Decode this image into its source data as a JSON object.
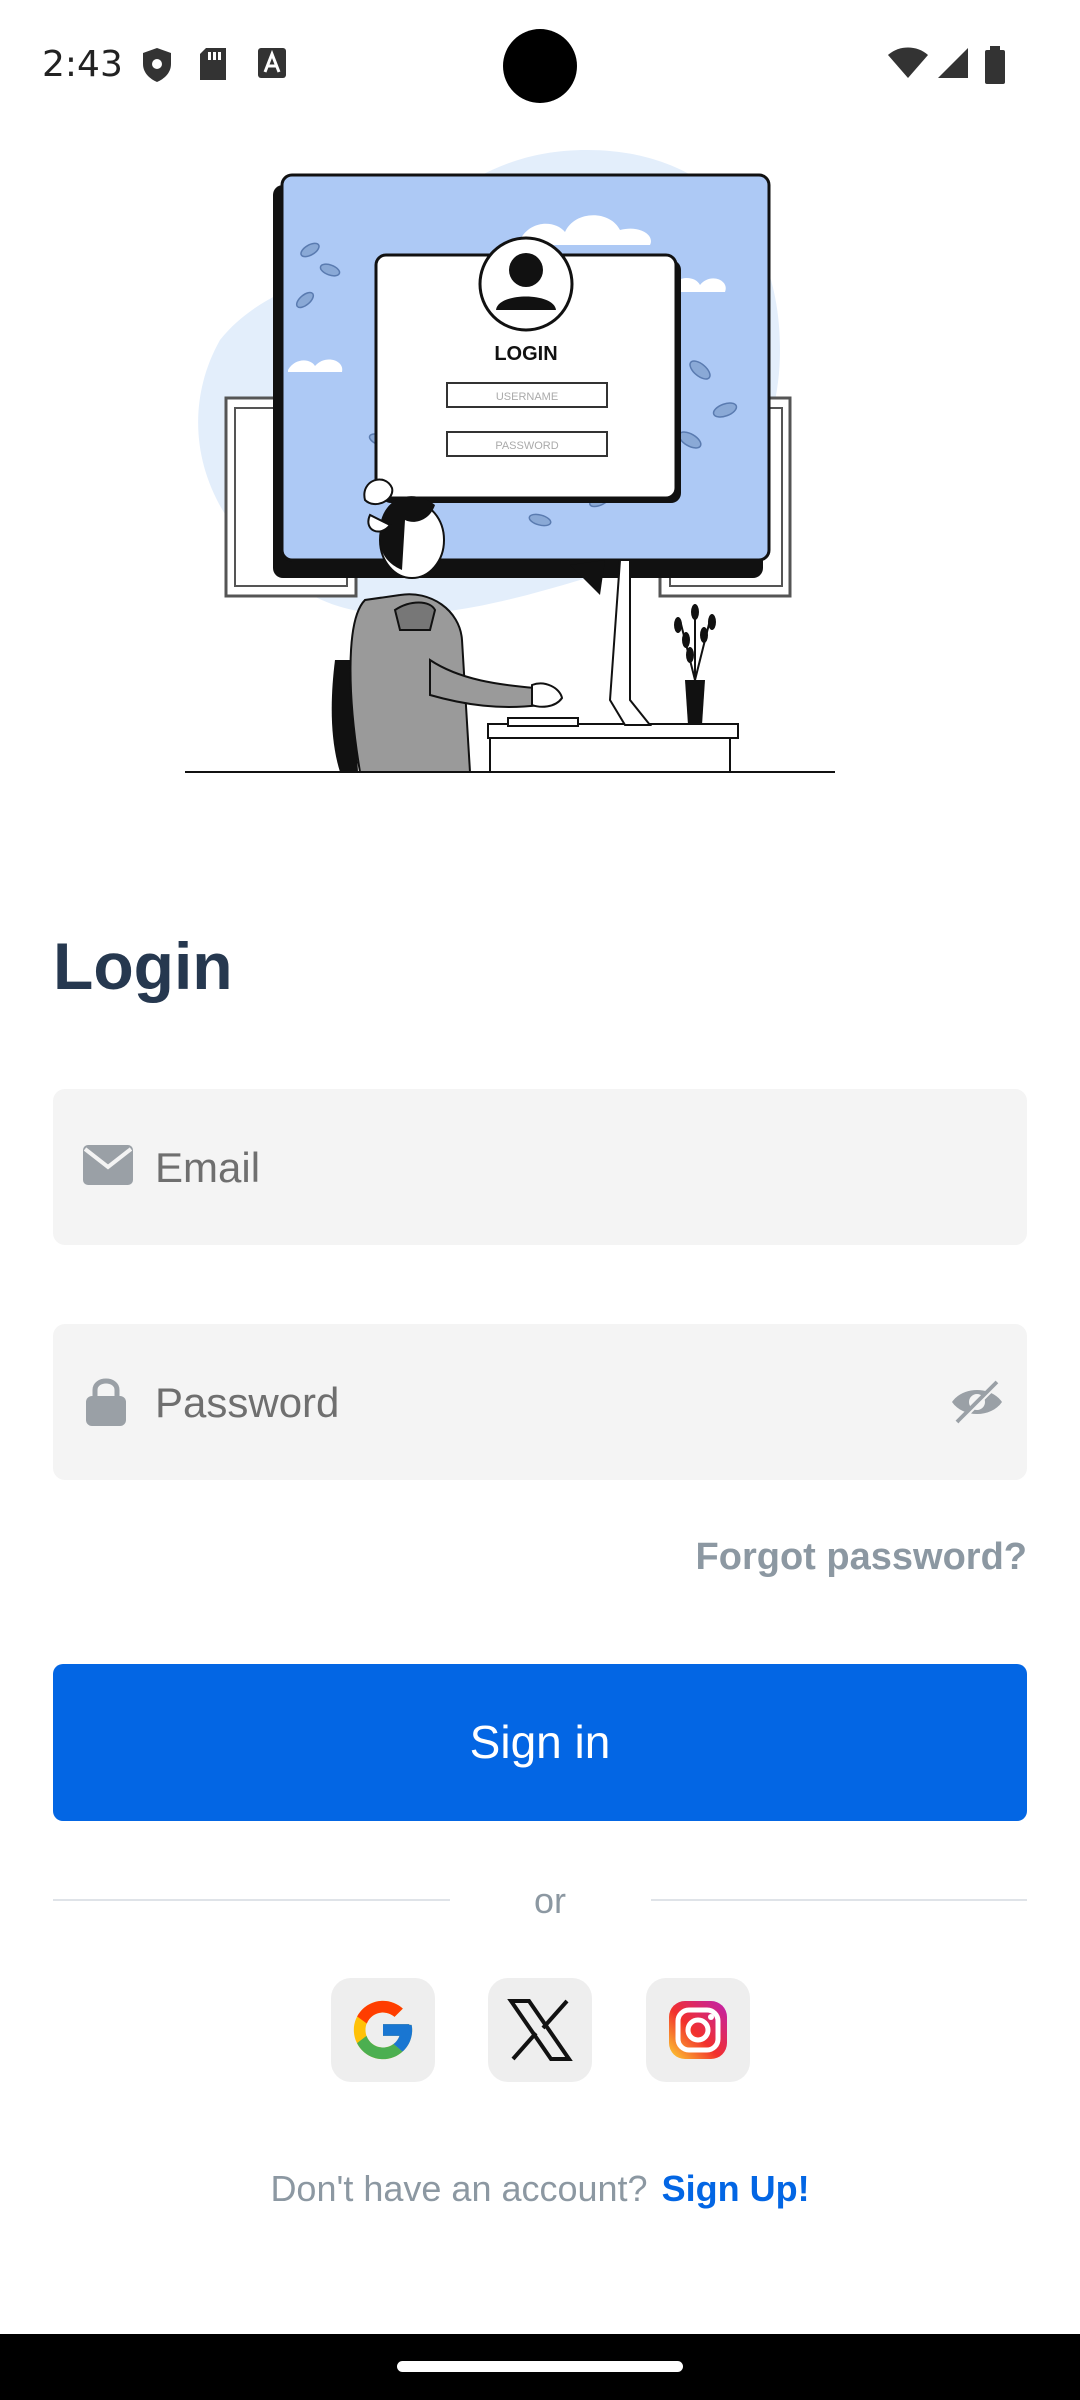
{
  "status_bar": {
    "time": "2:43"
  },
  "illustration": {
    "card_title": "LOGIN",
    "username_label": "USERNAME",
    "password_label": "PASSWORD"
  },
  "login": {
    "title": "Login",
    "email_placeholder": "Email",
    "password_placeholder": "Password",
    "forgot_password": "Forgot password?",
    "sign_in": "Sign in",
    "or": "or",
    "social": [
      "google-icon",
      "x-icon",
      "instagram-icon"
    ],
    "no_account": "Don't have an account?",
    "sign_up": "Sign Up!"
  },
  "colors": {
    "primary": "#0366e4",
    "title": "#26384f",
    "muted": "#8c98a2",
    "field_bg": "#f4f4f4"
  }
}
